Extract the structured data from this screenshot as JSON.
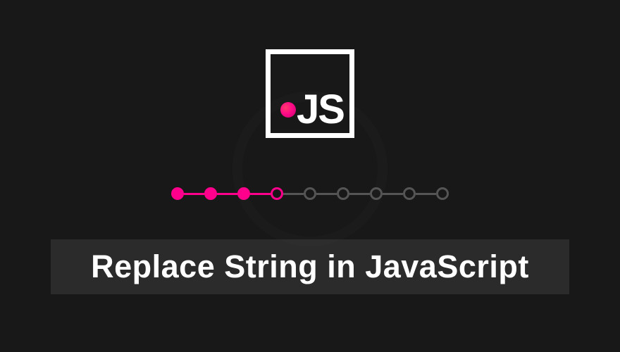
{
  "logo": {
    "label": "JS"
  },
  "title": "Replace String in JavaScript",
  "progress": {
    "total_nodes": 9,
    "filled_count": 3,
    "active_index": 3
  }
}
